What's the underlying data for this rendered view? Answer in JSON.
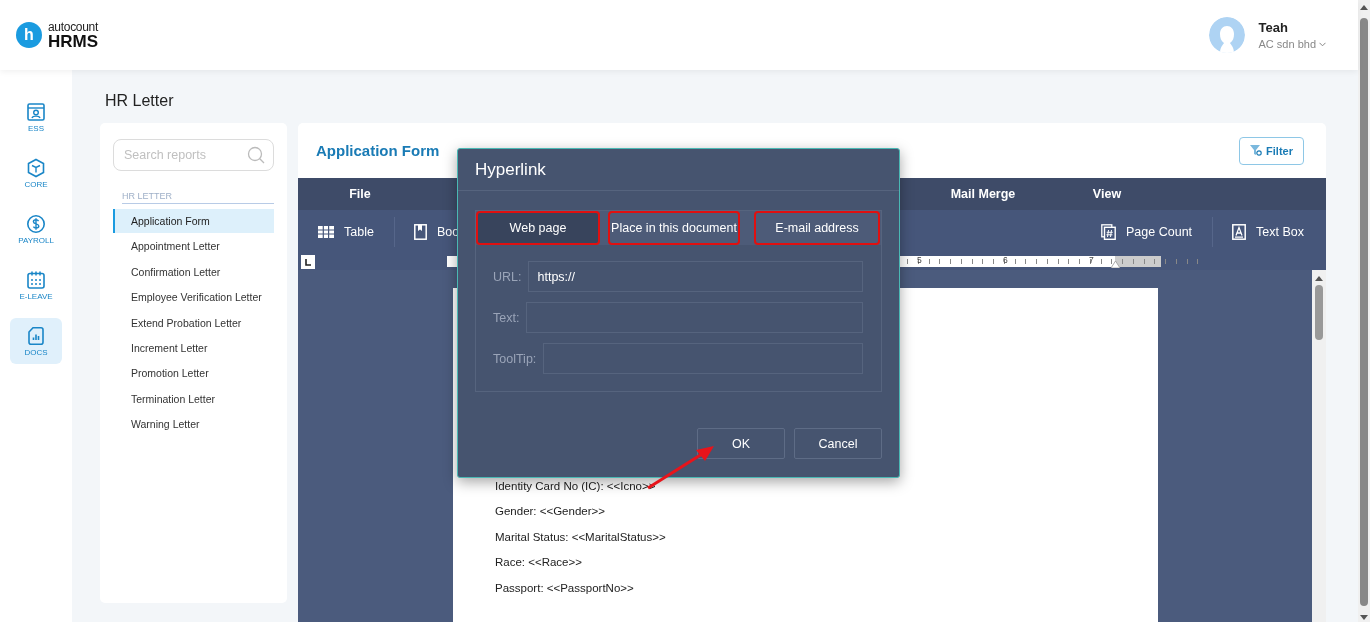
{
  "header": {
    "logo_letter": "h",
    "logo_small": "autocount",
    "logo_big": "HRMS",
    "user": {
      "name": "Teah",
      "company": "AC sdn bhd"
    }
  },
  "nav": [
    {
      "label": "ESS",
      "kind": "ess",
      "selected": false
    },
    {
      "label": "CORE",
      "kind": "core",
      "selected": false
    },
    {
      "label": "PAYROLL",
      "kind": "payroll",
      "selected": false
    },
    {
      "label": "E-LEAVE",
      "kind": "leave",
      "selected": false
    },
    {
      "label": "DOCS",
      "kind": "docs",
      "selected": true
    }
  ],
  "page_title": "HR Letter",
  "reports": {
    "search_placeholder": "Search reports",
    "section": "HR LETTER",
    "items": [
      {
        "label": "Application Form",
        "selected": true
      },
      {
        "label": "Appointment Letter",
        "selected": false
      },
      {
        "label": "Confirmation Letter",
        "selected": false
      },
      {
        "label": "Employee Verification Letter",
        "selected": false
      },
      {
        "label": "Extend Probation Letter",
        "selected": false
      },
      {
        "label": "Increment Letter",
        "selected": false
      },
      {
        "label": "Promotion Letter",
        "selected": false
      },
      {
        "label": "Termination Letter",
        "selected": false
      },
      {
        "label": "Warning Letter",
        "selected": false
      }
    ]
  },
  "form": {
    "title": "Application Form",
    "filter_button": "Filter",
    "ribbon_tabs_left": [
      "File"
    ],
    "ribbon_tabs_right": [
      "Mail Merge",
      "View"
    ],
    "toolbar_left": [
      {
        "label": "Table",
        "kind": "table"
      },
      {
        "label": "Boo",
        "kind": "bookmark"
      }
    ],
    "toolbar_right": [
      {
        "label": "Page Count",
        "kind": "page-count"
      },
      {
        "label": "Text Box",
        "kind": "text-box"
      }
    ],
    "ruler_labels": [
      "5",
      "6",
      "7"
    ],
    "document_lines": [
      "Identity Card No (IC): <<Icno>>",
      "Gender: <<Gender>>",
      "Marital Status: <<MaritalStatus>>",
      "Race: <<Race>>",
      "Passport: <<PassportNo>>"
    ]
  },
  "dialog": {
    "title": "Hyperlink",
    "tabs": [
      {
        "label": "Web page",
        "selected": true,
        "annotated": true
      },
      {
        "label": "Place in this document",
        "selected": false,
        "annotated": true
      },
      {
        "label": "E-mail address",
        "selected": false,
        "annotated": true
      }
    ],
    "fields": [
      {
        "label": "URL:",
        "value": "https://"
      },
      {
        "label": "Text:"
      },
      {
        "label": "ToolTip:"
      }
    ],
    "buttons": [
      "OK",
      "Cancel"
    ]
  }
}
